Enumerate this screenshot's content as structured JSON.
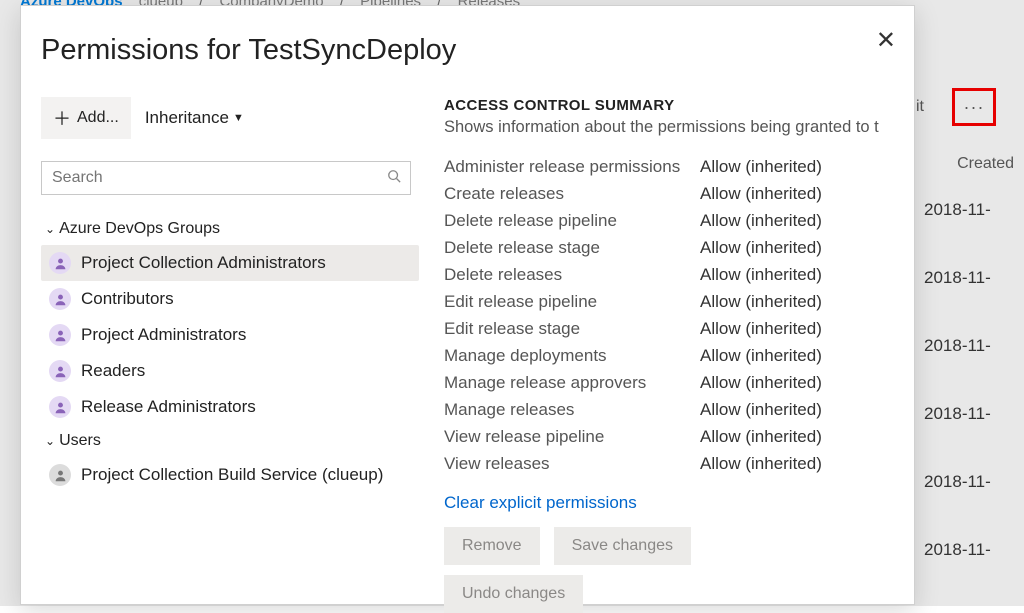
{
  "topbar": {
    "brand": "Azure DevOps",
    "crumbs": [
      "clueup",
      "CompanyDemo",
      "Pipelines",
      "Releases"
    ]
  },
  "bg": {
    "edit": "dit",
    "head": "Created",
    "dates": [
      "2018-11-",
      "2018-11-",
      "2018-11-",
      "2018-11-",
      "2018-11-",
      "2018-11-"
    ],
    "dots": "···"
  },
  "modal": {
    "title": "Permissions for TestSyncDeploy",
    "add_label": "Add...",
    "inheritance_label": "Inheritance",
    "search_placeholder": "Search",
    "groups_header": "Azure DevOps Groups",
    "users_header": "Users",
    "groups": [
      {
        "label": "Project Collection Administrators",
        "selected": true
      },
      {
        "label": "Contributors",
        "selected": false
      },
      {
        "label": "Project Administrators",
        "selected": false
      },
      {
        "label": "Readers",
        "selected": false
      },
      {
        "label": "Release Administrators",
        "selected": false
      }
    ],
    "users": [
      {
        "label": "Project Collection Build Service (clueup)"
      }
    ]
  },
  "acs": {
    "heading": "ACCESS CONTROL SUMMARY",
    "sub": "Shows information about the permissions being granted to t",
    "rows": [
      {
        "label": "Administer release permissions",
        "value": "Allow (inherited)"
      },
      {
        "label": "Create releases",
        "value": "Allow (inherited)"
      },
      {
        "label": "Delete release pipeline",
        "value": "Allow (inherited)"
      },
      {
        "label": "Delete release stage",
        "value": "Allow (inherited)"
      },
      {
        "label": "Delete releases",
        "value": "Allow (inherited)"
      },
      {
        "label": "Edit release pipeline",
        "value": "Allow (inherited)"
      },
      {
        "label": "Edit release stage",
        "value": "Allow (inherited)"
      },
      {
        "label": "Manage deployments",
        "value": "Allow (inherited)"
      },
      {
        "label": "Manage release approvers",
        "value": "Allow (inherited)"
      },
      {
        "label": "Manage releases",
        "value": "Allow (inherited)"
      },
      {
        "label": "View release pipeline",
        "value": "Allow (inherited)"
      },
      {
        "label": "View releases",
        "value": "Allow (inherited)"
      }
    ],
    "clear": "Clear explicit permissions",
    "remove": "Remove",
    "save": "Save changes",
    "undo": "Undo changes"
  }
}
